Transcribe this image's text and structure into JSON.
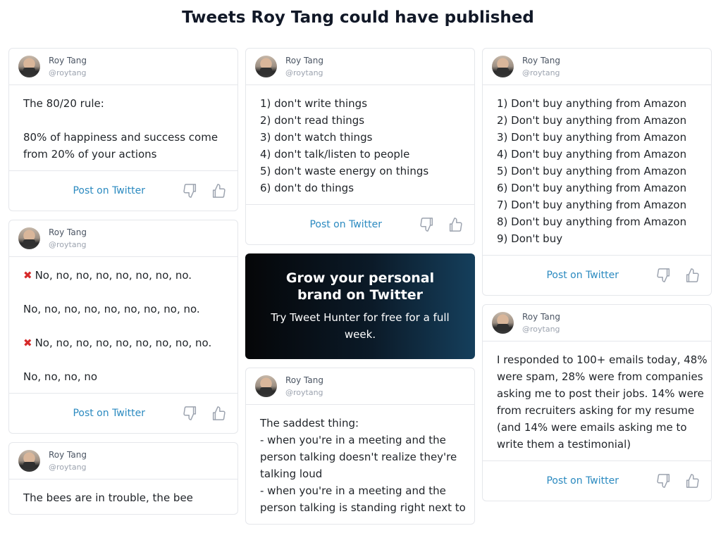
{
  "page": {
    "title": "Tweets Roy Tang could have published"
  },
  "author": {
    "name": "Roy Tang",
    "handle": "@roytang"
  },
  "actions": {
    "post_label": "Post on Twitter"
  },
  "promo": {
    "title": "Grow your personal brand on Twitter",
    "subtitle": "Try Tweet Hunter for free for a full week."
  },
  "columns": [
    {
      "tweets": [
        {
          "lines": [
            "The 80/20 rule:",
            "",
            "80% of happiness and success come",
            "from 20% of your actions"
          ]
        },
        {
          "lines": [
            "No, no, no, no, no, no, no, no.",
            "",
            "No, no, no, no, no, no, no, no, no.",
            "",
            "No, no, no, no, no, no, no, no, no.",
            "",
            "No, no, no, no"
          ]
        },
        {
          "lines": [
            "The bees are in trouble, the bee"
          ]
        }
      ]
    },
    {
      "tweets": [
        {
          "lines": [
            "1) don't write things",
            "2) don't read things",
            "3) don't watch things",
            "4) don't talk/listen to people",
            "5) don't waste energy on things",
            "6) don't do things"
          ]
        },
        {
          "lines": [
            "The saddest thing:",
            "- when you're in a meeting and the",
            "person talking doesn't realize they're",
            "talking loud",
            "- when you're in a meeting and the",
            "person talking is standing right next to"
          ]
        }
      ]
    },
    {
      "tweets": [
        {
          "lines": [
            "1) Don't buy anything from Amazon",
            "2) Don't buy anything from Amazon",
            "3) Don't buy anything from Amazon",
            "4) Don't buy anything from Amazon",
            "5) Don't buy anything from Amazon",
            "6) Don't buy anything from Amazon",
            "7) Don't buy anything from Amazon",
            "8) Don't buy anything from Amazon",
            "9) Don't buy"
          ]
        },
        {
          "lines": [
            "I responded to 100+ emails today, 48%",
            "were spam, 28% were from companies",
            "asking me to post their jobs. 14% were",
            "from recruiters asking for my resume",
            "(and 14% were emails asking me to",
            "write them a testimonial)"
          ]
        }
      ]
    }
  ],
  "icons": {
    "x_mark": "cross-mark-icon",
    "dislike": "thumbs-down-icon",
    "like": "thumbs-up-icon"
  },
  "colors": {
    "link": "#2b8ac0",
    "cross": "#d62a2a"
  }
}
